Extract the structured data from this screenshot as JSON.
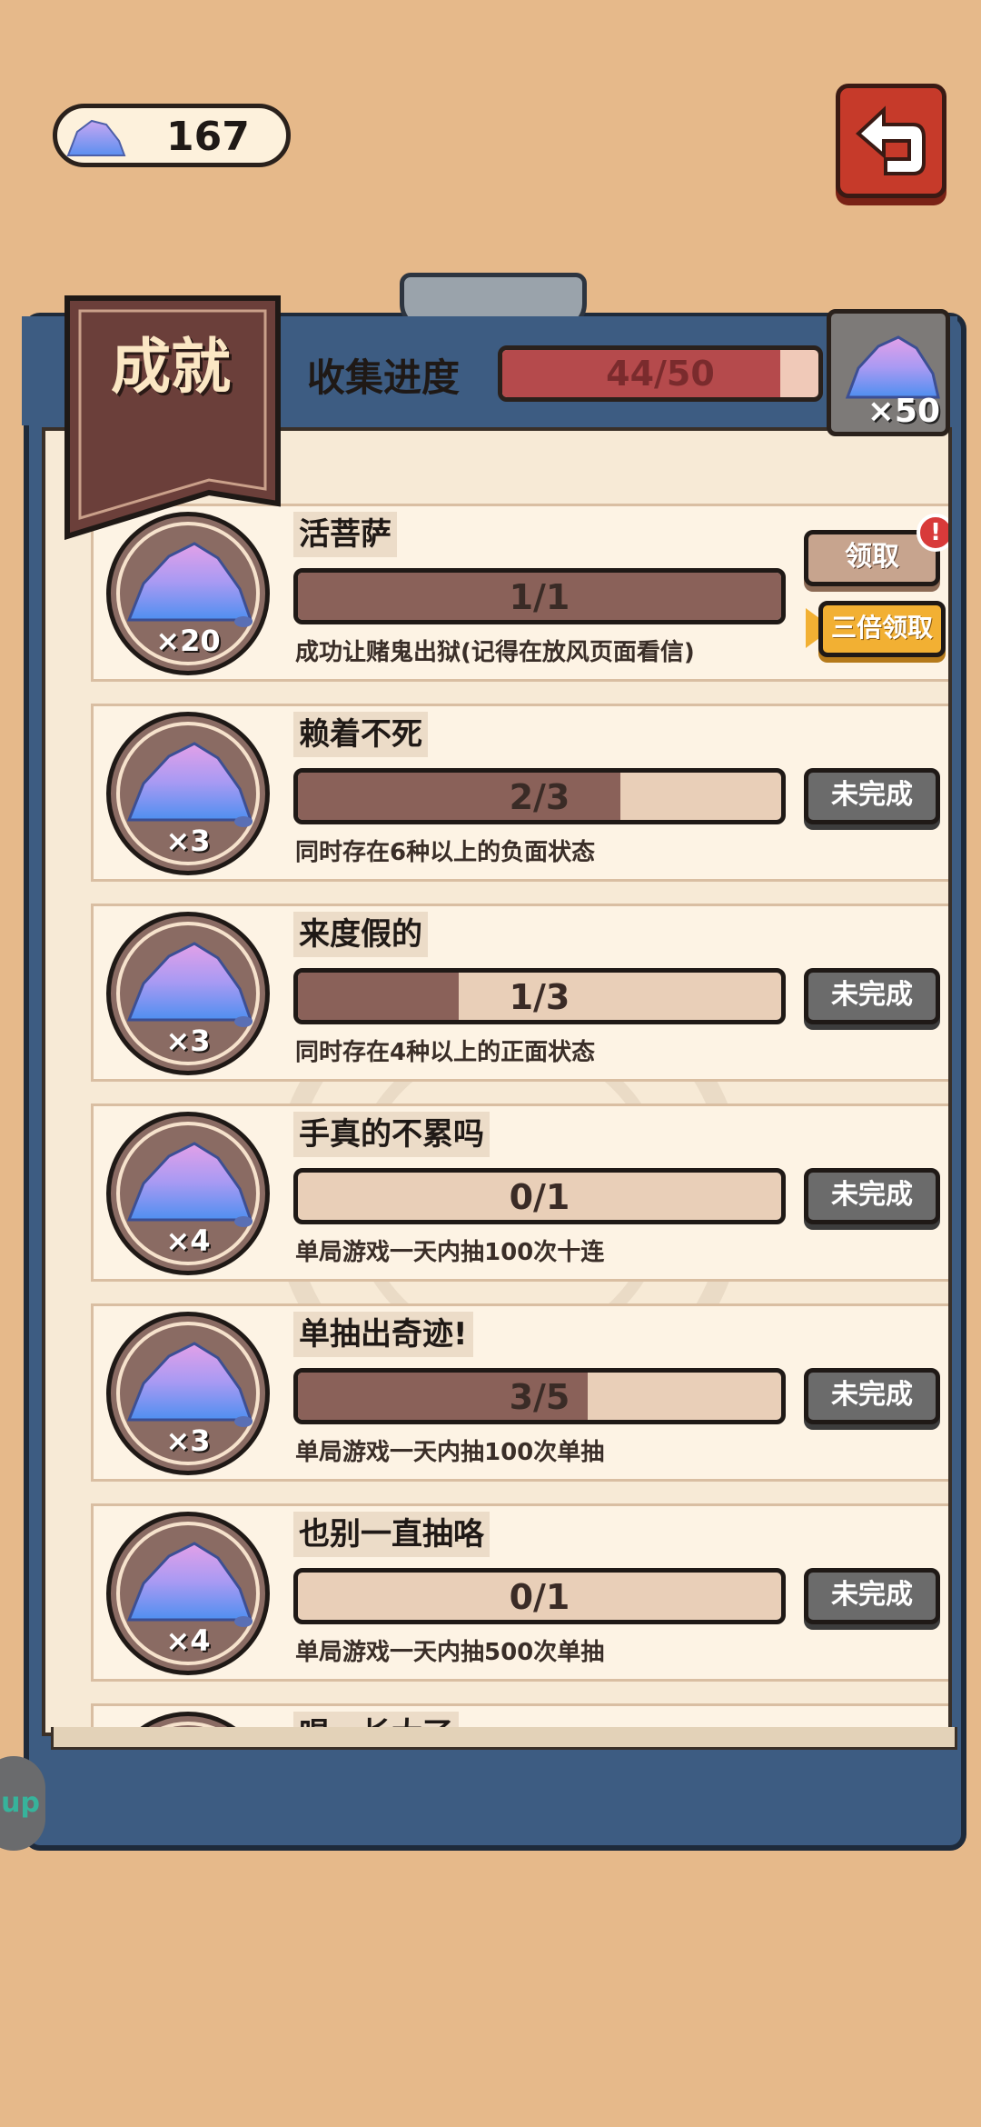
{
  "header": {
    "currency_value": "167",
    "back_icon": "back-arrow-icon"
  },
  "panel": {
    "title": "成就",
    "progress_label": "收集进度",
    "progress_text": "44/50",
    "progress_fraction": 0.88,
    "reward_qty": "×50"
  },
  "achievements": [
    {
      "name": "活菩萨",
      "progress": "1/1",
      "fraction": 1.0,
      "desc": "成功让赌鬼出狱(记得在放风页面看信)",
      "reward": "×20",
      "claim_label": "领取",
      "triple_label": "三倍领取",
      "alert": "!"
    },
    {
      "name": "赖着不死",
      "progress": "2/3",
      "fraction": 0.667,
      "desc": "同时存在6种以上的负面状态",
      "reward": "×3",
      "status_label": "未完成"
    },
    {
      "name": "来度假的",
      "progress": "1/3",
      "fraction": 0.333,
      "desc": "同时存在4种以上的正面状态",
      "reward": "×3",
      "status_label": "未完成"
    },
    {
      "name": "手真的不累吗",
      "progress": "0/1",
      "fraction": 0.0,
      "desc": "单局游戏一天内抽100次十连",
      "reward": "×4",
      "status_label": "未完成"
    },
    {
      "name": "单抽出奇迹!",
      "progress": "3/5",
      "fraction": 0.6,
      "desc": "单局游戏一天内抽100次单抽",
      "reward": "×3",
      "status_label": "未完成"
    },
    {
      "name": "也别一直抽咯",
      "progress": "0/1",
      "fraction": 0.0,
      "desc": "单局游戏一天内抽500次单抽",
      "reward": "×4",
      "status_label": "未完成"
    }
  ],
  "partial_row_name": "唱，长大了",
  "side_chip_text": "up"
}
